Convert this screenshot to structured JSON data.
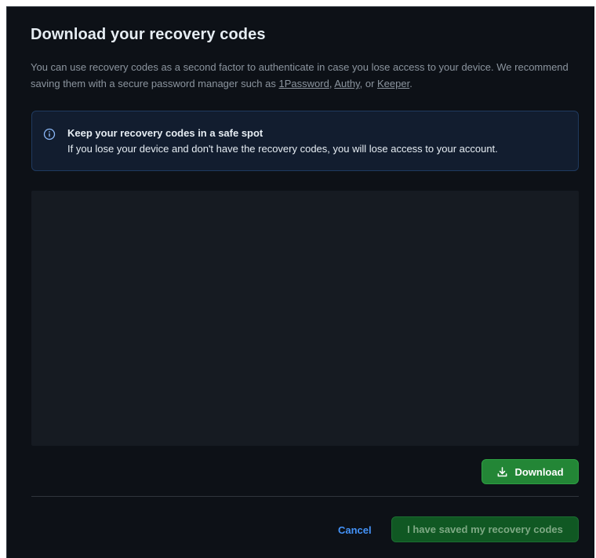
{
  "dialog": {
    "title": "Download your recovery codes",
    "description_before": "You can use recovery codes as a second factor to authenticate in case you lose access to your device. We recommend saving them with a secure password manager such as ",
    "link_1password": "1Password",
    "sep_1": ", ",
    "link_authy": "Authy",
    "sep_2": ", or ",
    "link_keeper": "Keeper",
    "description_end": "."
  },
  "callout": {
    "icon": "info-icon",
    "title": "Keep your recovery codes in a safe spot",
    "text": "If you lose your device and don't have the recovery codes, you will lose access to your account."
  },
  "actions": {
    "download_icon": "download-icon",
    "download_label": "Download",
    "cancel_label": "Cancel",
    "saved_label": "I have saved my recovery codes"
  },
  "colors": {
    "background": "#0d1117",
    "primary_green": "#238636",
    "disabled_green": "#105823",
    "link_blue": "#4493f8",
    "callout_bg": "#121d2f"
  }
}
